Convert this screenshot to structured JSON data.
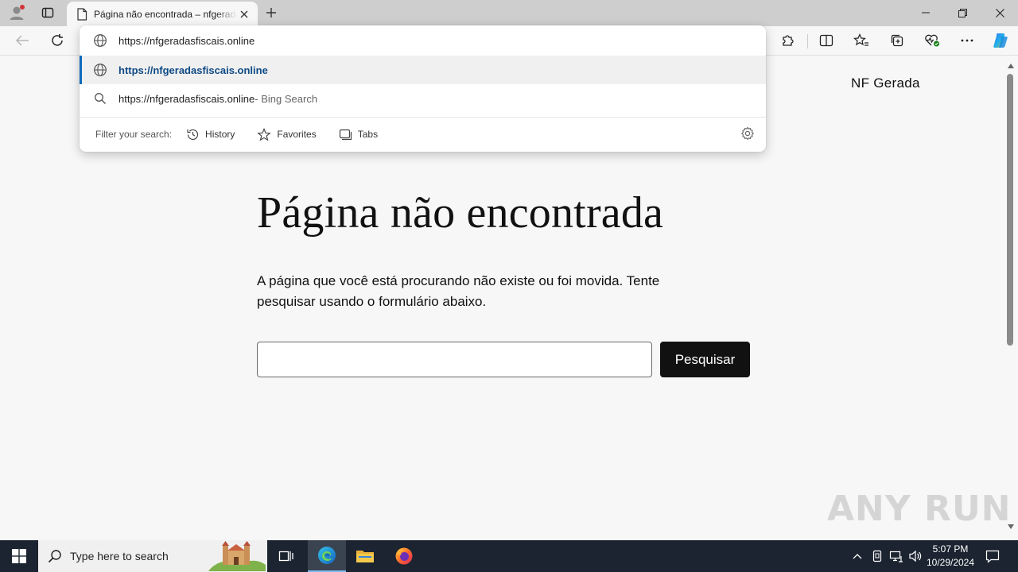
{
  "browser": {
    "tab": {
      "title": "Página não encontrada – nfgeradasfiscais"
    },
    "address_bar": {
      "value": "https://nfgeradasfiscais.online"
    },
    "suggestions": [
      {
        "text": "https://nfgeradasfiscais.online",
        "suffix": "",
        "icon": "globe-icon",
        "selected": true
      },
      {
        "text": "https://nfgeradasfiscais.online",
        "suffix": " - Bing Search",
        "icon": "search-icon",
        "selected": false
      }
    ],
    "filter": {
      "label": "Filter your search:",
      "chips": [
        {
          "label": "History",
          "icon": "history-icon"
        },
        {
          "label": "Favorites",
          "icon": "star-icon"
        },
        {
          "label": "Tabs",
          "icon": "tabs-icon"
        }
      ]
    }
  },
  "page": {
    "site_name": "NF Gerada",
    "heading": "Página não encontrada",
    "message": "A página que você está procurando não existe ou foi movida. Tente pesquisar usando o formulário abaixo.",
    "search_input": {
      "value": "",
      "placeholder": ""
    },
    "search_button": "Pesquisar"
  },
  "watermark": "ANY RUN",
  "taskbar": {
    "search_placeholder": "Type here to search",
    "time": "5:07 PM",
    "date": "10/29/2024"
  },
  "colors": {
    "accent": "#0f6cbd",
    "selected_text": "#0f4a85",
    "button_bg": "#111111",
    "taskbar_bg": "#1b2430"
  }
}
